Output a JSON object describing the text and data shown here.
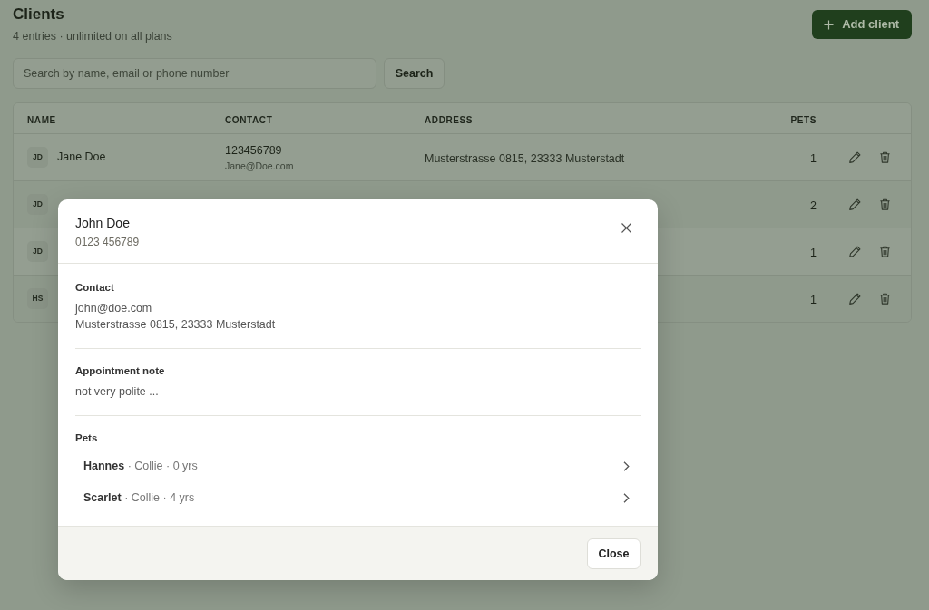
{
  "page": {
    "title": "Clients",
    "subtitle": "4 entries · unlimited on all plans",
    "add_button": "Add client"
  },
  "search": {
    "placeholder": "Search by name, email or phone number",
    "button": "Search"
  },
  "table": {
    "columns": [
      "NAME",
      "CONTACT",
      "ADDRESS",
      "PETS"
    ],
    "rows": [
      {
        "initials": "JD",
        "name": "Jane Doe",
        "phone": "123456789",
        "email": "Jane@Doe.com",
        "address": "Musterstrasse 0815, 23333 Musterstadt",
        "pets": "1"
      },
      {
        "initials": "JD",
        "pets": "2"
      },
      {
        "initials": "JD",
        "pets": "1"
      },
      {
        "initials": "HS",
        "pets": "1"
      }
    ]
  },
  "dialog": {
    "title": "John Doe",
    "subtitle": "0123 456789",
    "sections": [
      {
        "kind": "text",
        "heading": "Contact",
        "lines": [
          "john@doe.com",
          "Musterstrasse 0815, 23333 Musterstadt"
        ]
      },
      {
        "kind": "text",
        "heading": "Appointment note",
        "lines": [
          "not very polite ..."
        ]
      },
      {
        "kind": "list",
        "heading": "Pets",
        "items": [
          "**Hannes** · Collie · 0 yrs",
          "**Scarlet** · Collie · 4 yrs"
        ]
      }
    ],
    "close_button": "Close"
  }
}
